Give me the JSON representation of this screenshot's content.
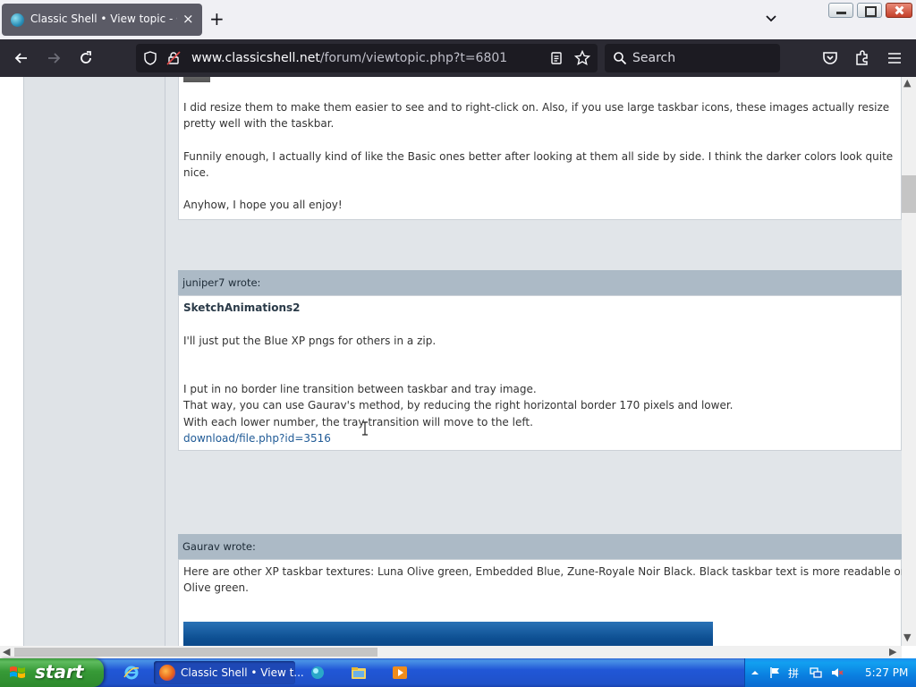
{
  "browser": {
    "tab_title": "Classic Shell • View topic - OS S",
    "tab_close": "×",
    "new_tab": "+",
    "url_host": "www.classicshell.net",
    "url_path": "/forum/viewtopic.php?t=6801",
    "search_placeholder": "Search"
  },
  "posts": [
    {
      "author": "",
      "paragraphs": [
        "I did resize them to make them easier to see and to right-click on. Also, if you use large taskbar icons, these images actually resize",
        "pretty well with the taskbar.",
        "Funnily enough, I actually kind of like the Basic ones better after looking at them all side by side. I think the darker colors look quite",
        "nice.",
        "Anyhow, I hope you all enjoy!"
      ]
    },
    {
      "author": "juniper7 wrote:",
      "subject": "SketchAnimations2",
      "paragraphs": [
        "I'll just put the Blue XP pngs for others in a zip.",
        "I put in no border line transition between taskbar and tray image.",
        "That way, you can use Gaurav's method, by reducing the right horizontal border 170 pixels and lower.",
        "With each lower number, the tray transition will move to the left."
      ],
      "link": "download/file.php?id=3516"
    },
    {
      "author": "Gaurav wrote:",
      "paragraphs": [
        "Here are other XP taskbar textures: Luna Olive green, Embedded Blue, Zune-Royale Noir Black. Black taskbar text is more readable on",
        "Olive green."
      ]
    }
  ],
  "taskbar": {
    "start_label": "start",
    "task_label": "Classic Shell • View t...",
    "clock": "5:27 PM"
  },
  "colors": {
    "post_header": "#acbac6",
    "taskbar_blue": "#2157d7",
    "start_green": "#379a37"
  }
}
